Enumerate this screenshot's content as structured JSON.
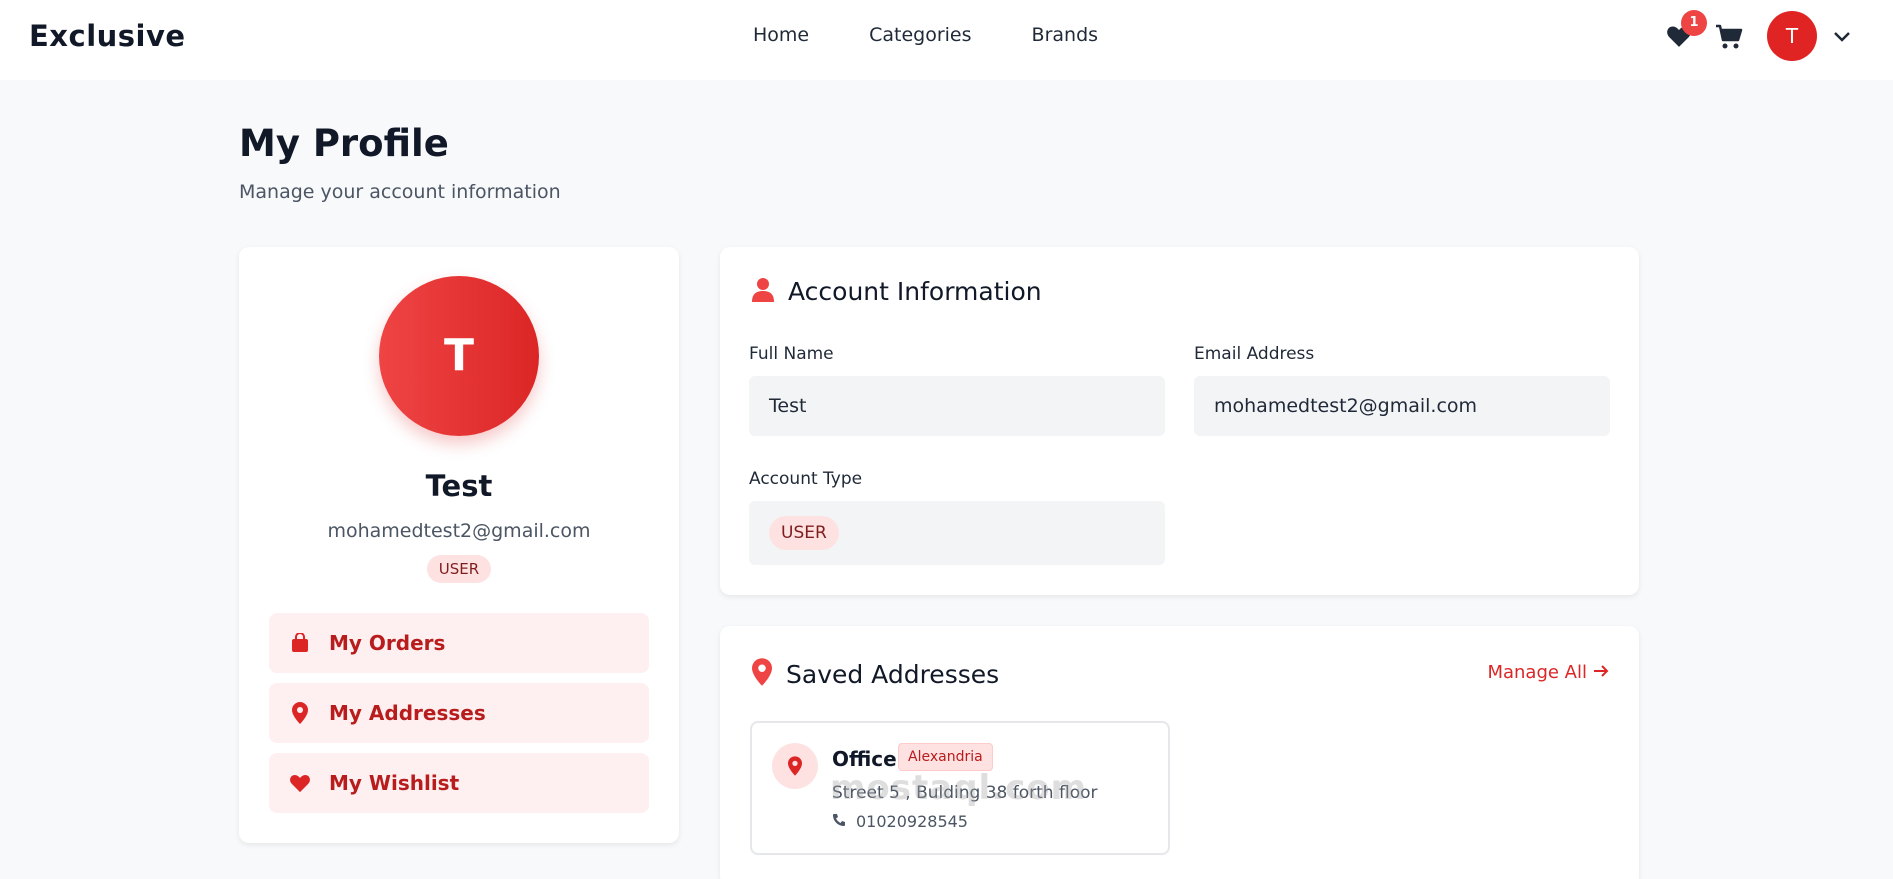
{
  "header": {
    "logo": "Exclusive",
    "nav": [
      "Home",
      "Categories",
      "Brands"
    ],
    "wishlist_count": "1",
    "avatar_initial": "T"
  },
  "page": {
    "title": "My Profile",
    "subtitle": "Manage your account information"
  },
  "profile": {
    "initial": "T",
    "name": "Test",
    "email": "mohamedtest2@gmail.com",
    "role": "USER",
    "menu": [
      {
        "label": "My Orders",
        "icon": "shopping-bag-icon"
      },
      {
        "label": "My Addresses",
        "icon": "map-pin-icon"
      },
      {
        "label": "My Wishlist",
        "icon": "heart-icon"
      }
    ]
  },
  "account": {
    "title": "Account Information",
    "full_name_label": "Full Name",
    "full_name_value": "Test",
    "email_label": "Email Address",
    "email_value": "mohamedtest2@gmail.com",
    "type_label": "Account Type",
    "type_value": "USER"
  },
  "addresses": {
    "title": "Saved Addresses",
    "manage_label": "Manage All",
    "items": [
      {
        "name": "Office",
        "city": "Alexandria",
        "street": "Street 5 , Bulding 38 forth floor",
        "phone": "01020928545"
      }
    ]
  },
  "watermark": "mostaql.com",
  "colors": {
    "accent": "#dc2626",
    "accent_light": "#fee2e2",
    "background": "#f8f9fb"
  }
}
